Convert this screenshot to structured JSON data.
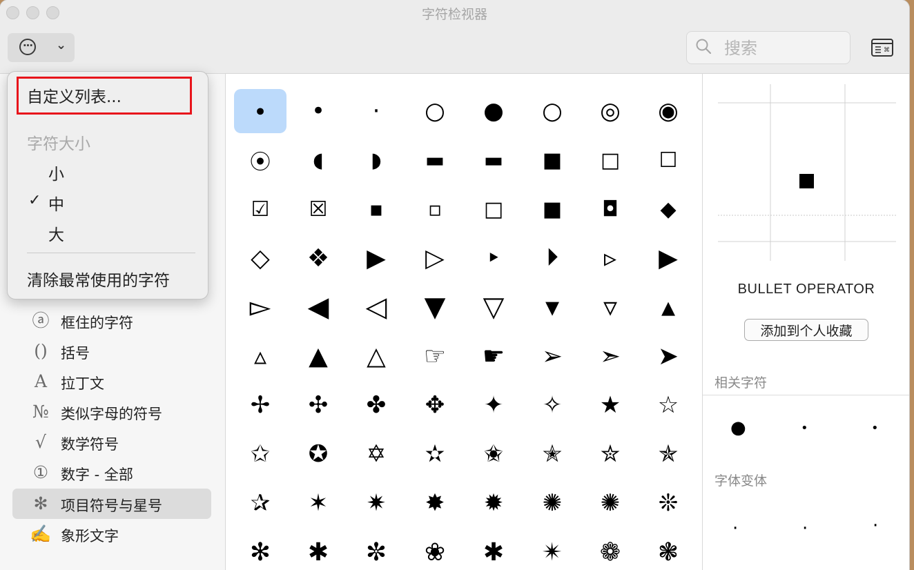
{
  "window": {
    "title": "字符检视器"
  },
  "toolbar": {
    "search_placeholder": "搜索",
    "action_menu_icon": "ellipsis-circle-icon",
    "dropdown_icon": "chevron-down-icon",
    "keyboard_viewer_icon": "keyboard-viewer-icon"
  },
  "menu": {
    "customize": "自定义列表...",
    "size_header": "字符大小",
    "size_small": "小",
    "size_medium": "中",
    "size_large": "大",
    "checkmark": "✓",
    "clear": "清除最常使用的字符"
  },
  "sidebar": {
    "items": [
      {
        "icon": "ⓐ",
        "label": "框住的字符"
      },
      {
        "icon": "()",
        "label": "括号"
      },
      {
        "icon": "A",
        "label": "拉丁文"
      },
      {
        "icon": "№",
        "label": "类似字母的符号"
      },
      {
        "icon": "√",
        "label": "数学符号"
      },
      {
        "icon": "①",
        "label": "数字 - 全部"
      },
      {
        "icon": "✻",
        "label": "项目符号与星号"
      },
      {
        "icon": "✍",
        "label": "象形文字"
      }
    ]
  },
  "grid": {
    "rows": [
      [
        "∙",
        "•",
        "·",
        "○",
        "●",
        "○",
        "◎",
        "◉"
      ],
      [
        "⦿",
        "◖",
        "◗",
        "▬",
        "▬",
        "■",
        "□",
        "☐"
      ],
      [
        "☑",
        "☒",
        "▪",
        "▫",
        "□",
        "■",
        "◘",
        "◆"
      ],
      [
        "◇",
        "❖",
        "▶",
        "▷",
        "‣",
        "⏵",
        "▹",
        "▶"
      ],
      [
        "▻",
        "◀",
        "◁",
        "▼",
        "▽",
        "▾",
        "▿",
        "▴"
      ],
      [
        "▵",
        "▲",
        "△",
        "☞",
        "☛",
        "➢",
        "➣",
        "➤"
      ],
      [
        "✢",
        "✣",
        "✤",
        "✥",
        "✦",
        "✧",
        "★",
        "☆"
      ],
      [
        "✩",
        "✪",
        "✡",
        "✫",
        "✬",
        "✭",
        "✮",
        "✯"
      ],
      [
        "✰",
        "✶",
        "✷",
        "✸",
        "✹",
        "✺",
        "✺",
        "❊"
      ],
      [
        "✻",
        "✱",
        "✼",
        "❀",
        "✱",
        "✴",
        "❁",
        "❃"
      ]
    ]
  },
  "detail": {
    "glyph": "∙",
    "name": "BULLET OPERATOR",
    "add_favorite": "添加到个人收藏",
    "related_title": "相关字符",
    "related": [
      "●",
      "•",
      "•"
    ],
    "variants_title": "字体变体",
    "variants": [
      "·",
      "·",
      "·"
    ]
  }
}
